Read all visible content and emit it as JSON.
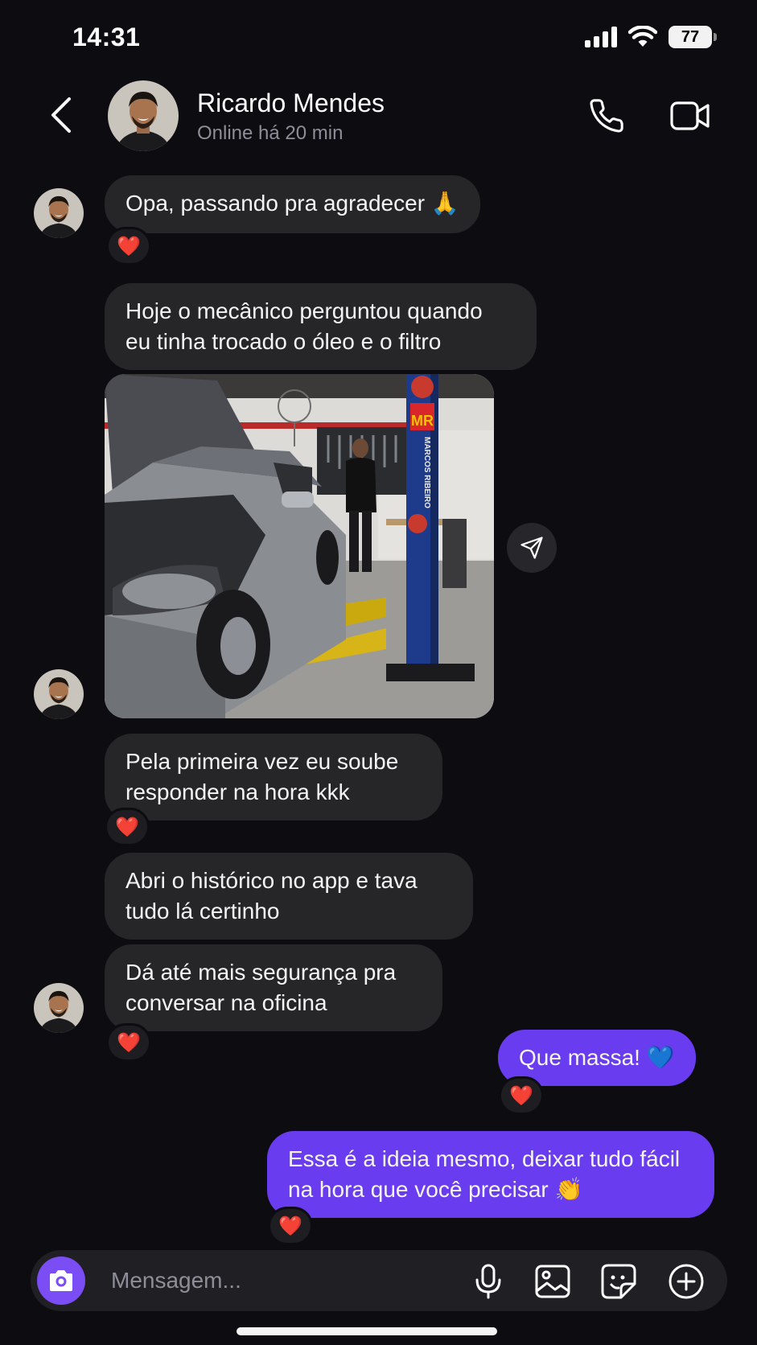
{
  "status_bar": {
    "time": "14:31",
    "battery": "77",
    "signal_icon": "cellular-signal-icon",
    "wifi_icon": "wifi-icon"
  },
  "header": {
    "name": "Ricardo Mendes",
    "status": "Online há 20 min"
  },
  "messages": [
    {
      "from": "Ricardo Mendes",
      "text": "Opa, passando pra agradecer 🙏",
      "reaction": "❤️"
    },
    {
      "from": "Ricardo Mendes",
      "text": "Hoje o mecânico perguntou quando\neu tinha trocado o óleo e o filtro"
    },
    {
      "from": "Ricardo Mendes",
      "type": "photo",
      "photo_signs": [
        "MR",
        "MARCOS RIBEIRO"
      ]
    },
    {
      "from": "Ricardo Mendes",
      "text": "Pela primeira vez eu soube\nresponder na hora kkk",
      "reaction": "❤️"
    },
    {
      "from": "Ricardo Mendes",
      "text": "Abri o histórico no app e tava\ntudo lá certinho"
    },
    {
      "from": "Ricardo Mendes",
      "text": "Dá até mais segurança pra\nconversar na oficina",
      "reaction": "❤️"
    },
    {
      "from": "me",
      "text": "Que massa! 💙",
      "reaction": "❤️"
    },
    {
      "from": "me",
      "text": "Essa é a ideia mesmo, deixar tudo fácil\nna hora que você precisar 👏",
      "reaction": "❤️"
    }
  ],
  "composer": {
    "placeholder": "Mensagem..."
  },
  "colors": {
    "background": "#0c0c11",
    "incoming_bubble": "#262629",
    "outgoing_bubble": "#6a3cf0",
    "camera_button": "#7a4df5"
  }
}
